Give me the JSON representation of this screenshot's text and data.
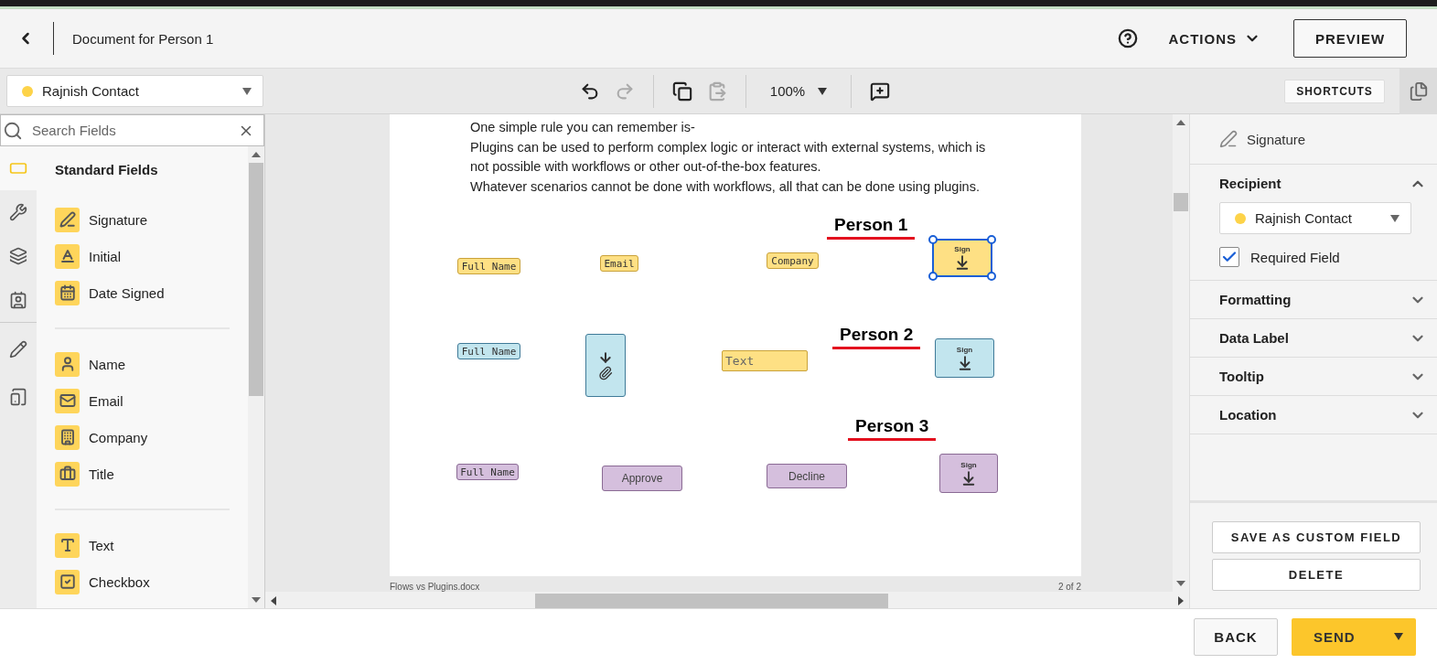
{
  "header": {
    "title": "Document for Person 1",
    "actions": "ACTIONS",
    "preview": "PREVIEW"
  },
  "toolbar": {
    "recipient": {
      "name": "Rajnish Contact",
      "color": "#fdd349"
    },
    "tools": [
      {
        "kind": "undo",
        "disabled": false
      },
      {
        "kind": "redo",
        "disabled": true
      },
      {
        "kind": "copy",
        "disabled": false
      },
      {
        "kind": "paste",
        "disabled": true
      }
    ],
    "zoom": "100%",
    "shortcuts": "SHORTCUTS"
  },
  "search": {
    "placeholder": "Search Fields"
  },
  "rail": [
    {
      "kind": "field",
      "selected": true
    },
    {
      "kind": "tools",
      "selected": false
    },
    {
      "kind": "layers",
      "selected": false
    },
    {
      "kind": "contact",
      "selected": false
    },
    {
      "kind": "pencil",
      "selected": false
    },
    {
      "kind": "devices",
      "selected": false
    }
  ],
  "fields_panel": {
    "title": "Standard Fields",
    "groups": [
      [
        {
          "kind": "signature",
          "label": "Signature"
        },
        {
          "kind": "initial",
          "label": "Initial"
        },
        {
          "kind": "date",
          "label": "Date Signed"
        }
      ],
      [
        {
          "kind": "name",
          "label": "Name"
        },
        {
          "kind": "email",
          "label": "Email"
        },
        {
          "kind": "company",
          "label": "Company"
        },
        {
          "kind": "title",
          "label": "Title"
        }
      ],
      [
        {
          "kind": "text",
          "label": "Text"
        },
        {
          "kind": "checkbox",
          "label": "Checkbox"
        }
      ]
    ]
  },
  "document": {
    "paragraphs": [
      "One simple rule you can remember is-",
      "Plugins can be used to perform complex logic or interact with external systems, which is not possible with workflows or other out-of-the-box features.",
      "Whatever scenarios cannot be done with workflows, all that can be done using plugins."
    ],
    "persons": [
      "Person 1",
      "Person 2",
      "Person 3"
    ],
    "fields": [
      {
        "kind": "tag",
        "label": "Full Name",
        "color": "#fee084",
        "selected": false
      },
      {
        "kind": "tag",
        "label": "Email",
        "color": "#fee084",
        "selected": false
      },
      {
        "kind": "tag",
        "label": "Company",
        "color": "#fee084",
        "selected": false
      },
      {
        "kind": "sign",
        "label": "Sign",
        "color": "#fee084",
        "selected": true
      },
      {
        "kind": "tag",
        "label": "Full Name",
        "color": "#c2e5ee",
        "selected": false
      },
      {
        "kind": "attachment",
        "color": "#c2e5ee",
        "selected": false
      },
      {
        "kind": "input",
        "label": "Text",
        "color": "#fee084",
        "selected": false
      },
      {
        "kind": "sign",
        "label": "Sign",
        "color": "#c2e5ee",
        "selected": false
      },
      {
        "kind": "tag",
        "label": "Full Name",
        "color": "#d5bfdd",
        "selected": false
      },
      {
        "kind": "button",
        "label": "Approve",
        "color": "#d5bfdd",
        "selected": false
      },
      {
        "kind": "button",
        "label": "Decline",
        "color": "#d5bfdd",
        "selected": false
      },
      {
        "kind": "sign",
        "label": "Sign",
        "color": "#d5bfdd",
        "selected": false
      }
    ],
    "file_name": "Flows vs Plugins.docx",
    "page": "2 of 2"
  },
  "properties": {
    "field_type": "Signature",
    "sections": [
      {
        "title": "Recipient",
        "expanded": true
      },
      {
        "title": "Formatting",
        "expanded": false
      },
      {
        "title": "Data Label",
        "expanded": false
      },
      {
        "title": "Tooltip",
        "expanded": false
      },
      {
        "title": "Location",
        "expanded": false
      }
    ],
    "recipient": {
      "name": "Rajnish Contact",
      "color": "#fdd349"
    },
    "required": {
      "label": "Required Field",
      "checked": true
    },
    "buttons": [
      "SAVE AS CUSTOM FIELD",
      "DELETE"
    ]
  },
  "footer": {
    "back": "BACK",
    "send": "SEND"
  }
}
